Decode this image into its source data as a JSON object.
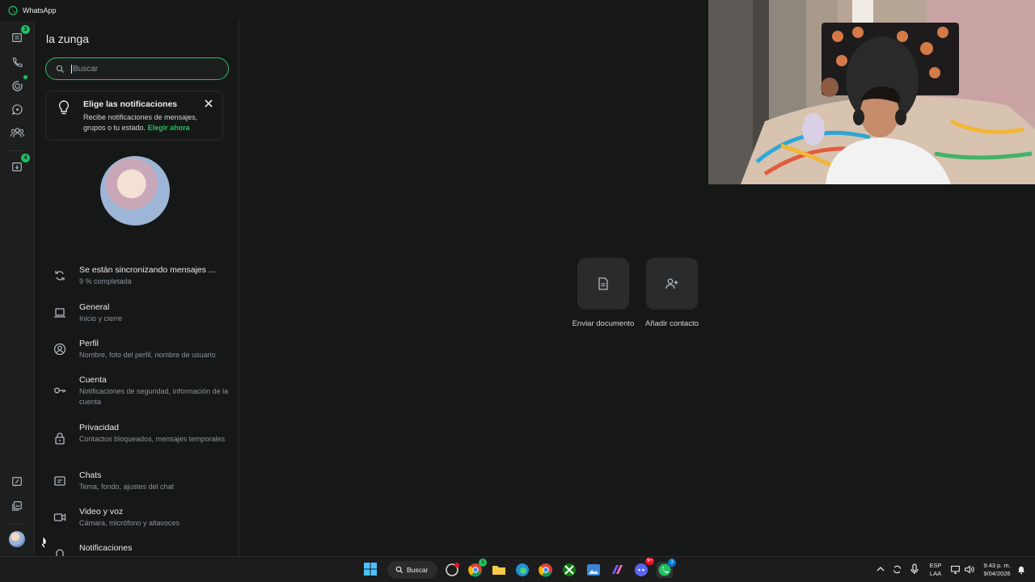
{
  "window": {
    "title": "WhatsApp"
  },
  "rail": {
    "chats_badge": "3",
    "archive_badge": "4"
  },
  "panel": {
    "title": "la zunga",
    "search_placeholder": "Buscar",
    "notification": {
      "title": "Elige las notificaciones",
      "body": "Recibe notificaciones de mensajes, grupos o tu estado.",
      "link": "Elegir ahora"
    },
    "items": [
      {
        "label": "Se están sincronizando mensajes ...",
        "sub": "9 % completada"
      },
      {
        "label": "General",
        "sub": "Inicio y cierre"
      },
      {
        "label": "Perfil",
        "sub": "Nombre, foto del perfil, nombre de usuario"
      },
      {
        "label": "Cuenta",
        "sub": "Notificaciones de seguridad, información de la cuenta"
      },
      {
        "label": "Privacidad",
        "sub": "Contactos bloqueados, mensajes temporales"
      },
      {
        "label": "Chats",
        "sub": "Tema, fondo, ajustes del chat"
      },
      {
        "label": "Video y voz",
        "sub": "Cámara, micrófono y altavoces"
      },
      {
        "label": "Notificaciones",
        "sub": ""
      }
    ]
  },
  "main": {
    "actions": [
      {
        "label": "Enviar documento",
        "icon": "document-icon"
      },
      {
        "label": "Añadir contacto",
        "icon": "add-contact-icon"
      }
    ]
  },
  "taskbar": {
    "search_label": "Buscar",
    "lang_top": "ESP",
    "lang_bottom": "LAA",
    "time": "9:43 p. m.",
    "date": "9/04/2026",
    "discord_badge": "9+",
    "chrome_badge": "1",
    "whatsapp_badge": "3"
  },
  "colors": {
    "accent": "#21c063",
    "background": "#161717",
    "card": "#2a2c2c"
  }
}
